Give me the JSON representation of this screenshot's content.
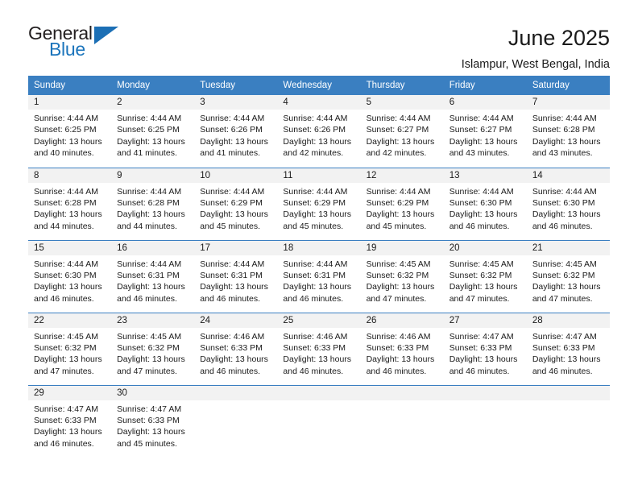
{
  "brand": {
    "name_part1": "General",
    "name_part2": "Blue",
    "triangle_color": "#1c6fb5",
    "blue_color": "#1c75bc"
  },
  "header": {
    "title": "June 2025",
    "subtitle": "Islampur, West Bengal, India"
  },
  "theme": {
    "header_bg": "#3a7fc1",
    "daynum_bg": "#f2f2f2",
    "text_color": "#1a1a1a"
  },
  "calendar": {
    "weekday_headers": [
      "Sunday",
      "Monday",
      "Tuesday",
      "Wednesday",
      "Thursday",
      "Friday",
      "Saturday"
    ],
    "weeks": [
      [
        {
          "day": "1",
          "sunrise": "Sunrise: 4:44 AM",
          "sunset": "Sunset: 6:25 PM",
          "daylight1": "Daylight: 13 hours",
          "daylight2": "and 40 minutes."
        },
        {
          "day": "2",
          "sunrise": "Sunrise: 4:44 AM",
          "sunset": "Sunset: 6:25 PM",
          "daylight1": "Daylight: 13 hours",
          "daylight2": "and 41 minutes."
        },
        {
          "day": "3",
          "sunrise": "Sunrise: 4:44 AM",
          "sunset": "Sunset: 6:26 PM",
          "daylight1": "Daylight: 13 hours",
          "daylight2": "and 41 minutes."
        },
        {
          "day": "4",
          "sunrise": "Sunrise: 4:44 AM",
          "sunset": "Sunset: 6:26 PM",
          "daylight1": "Daylight: 13 hours",
          "daylight2": "and 42 minutes."
        },
        {
          "day": "5",
          "sunrise": "Sunrise: 4:44 AM",
          "sunset": "Sunset: 6:27 PM",
          "daylight1": "Daylight: 13 hours",
          "daylight2": "and 42 minutes."
        },
        {
          "day": "6",
          "sunrise": "Sunrise: 4:44 AM",
          "sunset": "Sunset: 6:27 PM",
          "daylight1": "Daylight: 13 hours",
          "daylight2": "and 43 minutes."
        },
        {
          "day": "7",
          "sunrise": "Sunrise: 4:44 AM",
          "sunset": "Sunset: 6:28 PM",
          "daylight1": "Daylight: 13 hours",
          "daylight2": "and 43 minutes."
        }
      ],
      [
        {
          "day": "8",
          "sunrise": "Sunrise: 4:44 AM",
          "sunset": "Sunset: 6:28 PM",
          "daylight1": "Daylight: 13 hours",
          "daylight2": "and 44 minutes."
        },
        {
          "day": "9",
          "sunrise": "Sunrise: 4:44 AM",
          "sunset": "Sunset: 6:28 PM",
          "daylight1": "Daylight: 13 hours",
          "daylight2": "and 44 minutes."
        },
        {
          "day": "10",
          "sunrise": "Sunrise: 4:44 AM",
          "sunset": "Sunset: 6:29 PM",
          "daylight1": "Daylight: 13 hours",
          "daylight2": "and 45 minutes."
        },
        {
          "day": "11",
          "sunrise": "Sunrise: 4:44 AM",
          "sunset": "Sunset: 6:29 PM",
          "daylight1": "Daylight: 13 hours",
          "daylight2": "and 45 minutes."
        },
        {
          "day": "12",
          "sunrise": "Sunrise: 4:44 AM",
          "sunset": "Sunset: 6:29 PM",
          "daylight1": "Daylight: 13 hours",
          "daylight2": "and 45 minutes."
        },
        {
          "day": "13",
          "sunrise": "Sunrise: 4:44 AM",
          "sunset": "Sunset: 6:30 PM",
          "daylight1": "Daylight: 13 hours",
          "daylight2": "and 46 minutes."
        },
        {
          "day": "14",
          "sunrise": "Sunrise: 4:44 AM",
          "sunset": "Sunset: 6:30 PM",
          "daylight1": "Daylight: 13 hours",
          "daylight2": "and 46 minutes."
        }
      ],
      [
        {
          "day": "15",
          "sunrise": "Sunrise: 4:44 AM",
          "sunset": "Sunset: 6:30 PM",
          "daylight1": "Daylight: 13 hours",
          "daylight2": "and 46 minutes."
        },
        {
          "day": "16",
          "sunrise": "Sunrise: 4:44 AM",
          "sunset": "Sunset: 6:31 PM",
          "daylight1": "Daylight: 13 hours",
          "daylight2": "and 46 minutes."
        },
        {
          "day": "17",
          "sunrise": "Sunrise: 4:44 AM",
          "sunset": "Sunset: 6:31 PM",
          "daylight1": "Daylight: 13 hours",
          "daylight2": "and 46 minutes."
        },
        {
          "day": "18",
          "sunrise": "Sunrise: 4:44 AM",
          "sunset": "Sunset: 6:31 PM",
          "daylight1": "Daylight: 13 hours",
          "daylight2": "and 46 minutes."
        },
        {
          "day": "19",
          "sunrise": "Sunrise: 4:45 AM",
          "sunset": "Sunset: 6:32 PM",
          "daylight1": "Daylight: 13 hours",
          "daylight2": "and 47 minutes."
        },
        {
          "day": "20",
          "sunrise": "Sunrise: 4:45 AM",
          "sunset": "Sunset: 6:32 PM",
          "daylight1": "Daylight: 13 hours",
          "daylight2": "and 47 minutes."
        },
        {
          "day": "21",
          "sunrise": "Sunrise: 4:45 AM",
          "sunset": "Sunset: 6:32 PM",
          "daylight1": "Daylight: 13 hours",
          "daylight2": "and 47 minutes."
        }
      ],
      [
        {
          "day": "22",
          "sunrise": "Sunrise: 4:45 AM",
          "sunset": "Sunset: 6:32 PM",
          "daylight1": "Daylight: 13 hours",
          "daylight2": "and 47 minutes."
        },
        {
          "day": "23",
          "sunrise": "Sunrise: 4:45 AM",
          "sunset": "Sunset: 6:32 PM",
          "daylight1": "Daylight: 13 hours",
          "daylight2": "and 47 minutes."
        },
        {
          "day": "24",
          "sunrise": "Sunrise: 4:46 AM",
          "sunset": "Sunset: 6:33 PM",
          "daylight1": "Daylight: 13 hours",
          "daylight2": "and 46 minutes."
        },
        {
          "day": "25",
          "sunrise": "Sunrise: 4:46 AM",
          "sunset": "Sunset: 6:33 PM",
          "daylight1": "Daylight: 13 hours",
          "daylight2": "and 46 minutes."
        },
        {
          "day": "26",
          "sunrise": "Sunrise: 4:46 AM",
          "sunset": "Sunset: 6:33 PM",
          "daylight1": "Daylight: 13 hours",
          "daylight2": "and 46 minutes."
        },
        {
          "day": "27",
          "sunrise": "Sunrise: 4:47 AM",
          "sunset": "Sunset: 6:33 PM",
          "daylight1": "Daylight: 13 hours",
          "daylight2": "and 46 minutes."
        },
        {
          "day": "28",
          "sunrise": "Sunrise: 4:47 AM",
          "sunset": "Sunset: 6:33 PM",
          "daylight1": "Daylight: 13 hours",
          "daylight2": "and 46 minutes."
        }
      ],
      [
        {
          "day": "29",
          "sunrise": "Sunrise: 4:47 AM",
          "sunset": "Sunset: 6:33 PM",
          "daylight1": "Daylight: 13 hours",
          "daylight2": "and 46 minutes."
        },
        {
          "day": "30",
          "sunrise": "Sunrise: 4:47 AM",
          "sunset": "Sunset: 6:33 PM",
          "daylight1": "Daylight: 13 hours",
          "daylight2": "and 45 minutes."
        },
        {
          "day": "",
          "sunrise": "",
          "sunset": "",
          "daylight1": "",
          "daylight2": ""
        },
        {
          "day": "",
          "sunrise": "",
          "sunset": "",
          "daylight1": "",
          "daylight2": ""
        },
        {
          "day": "",
          "sunrise": "",
          "sunset": "",
          "daylight1": "",
          "daylight2": ""
        },
        {
          "day": "",
          "sunrise": "",
          "sunset": "",
          "daylight1": "",
          "daylight2": ""
        },
        {
          "day": "",
          "sunrise": "",
          "sunset": "",
          "daylight1": "",
          "daylight2": ""
        }
      ]
    ]
  }
}
